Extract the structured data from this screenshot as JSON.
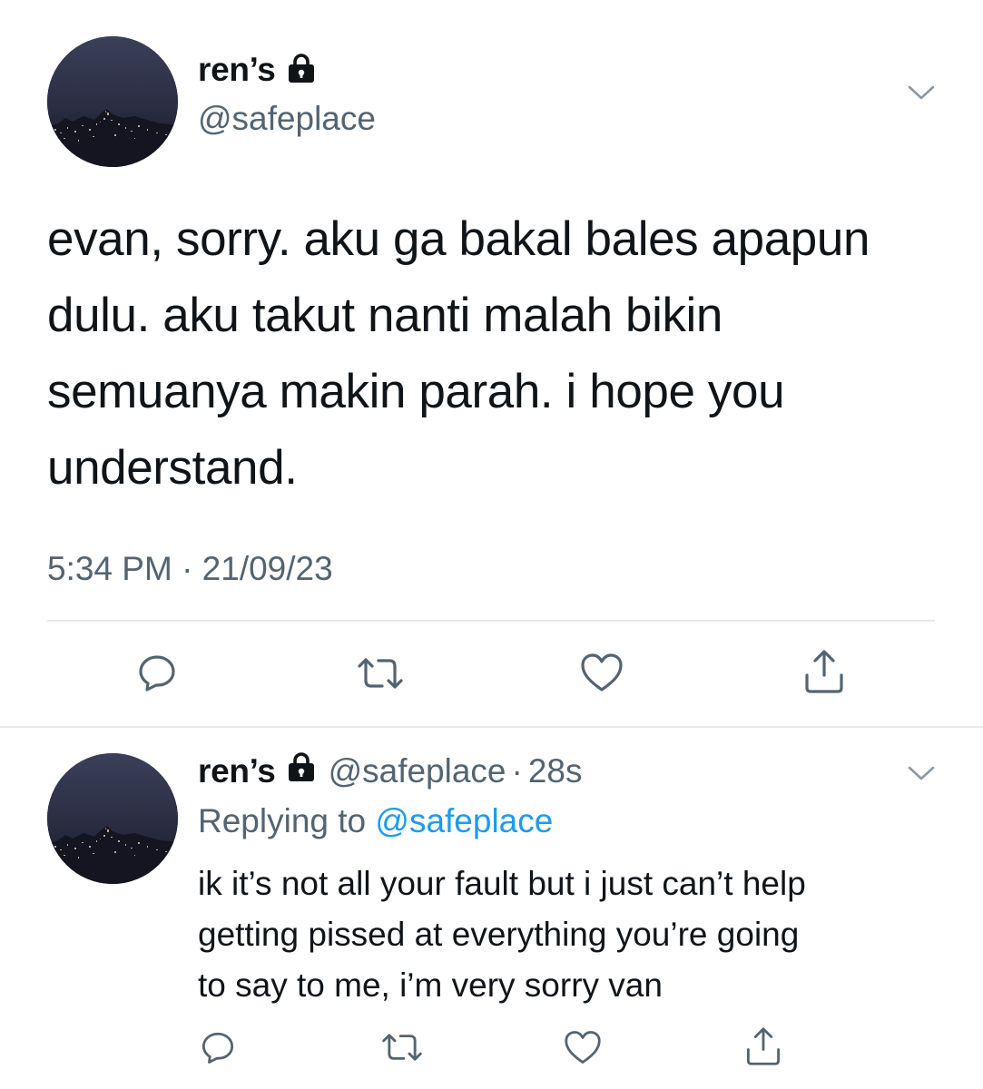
{
  "main_tweet": {
    "author_name": "ren’s",
    "handle": "@safeplace",
    "text": "evan, sorry. aku ga bakal bales apapun\ndulu. aku takut nanti malah bikin\nsemuanya makin parah. i hope you\nunderstand.",
    "timestamp": "5:34 PM · 21/09/23",
    "icons": {
      "protected": "lock-icon",
      "menu": "chevron-down-icon",
      "actions": [
        "reply-icon",
        "retweet-icon",
        "like-icon",
        "share-icon"
      ]
    }
  },
  "reply_tweet": {
    "author_name": "ren’s",
    "handle": "@safeplace",
    "separator": "·",
    "age": "28s",
    "replying_prefix": "Replying to",
    "replying_to": "@safeplace",
    "text": "ik it’s not all your fault but i just can’t help\ngetting pissed at everything you’re going\nto say to me, i’m very sorry van",
    "icons": {
      "protected": "lock-icon",
      "menu": "chevron-down-icon",
      "actions": [
        "reply-icon",
        "retweet-icon",
        "like-icon",
        "share-icon"
      ]
    }
  },
  "colors": {
    "text_primary": "#0f1419",
    "text_secondary": "#536471",
    "link": "#1d9bf0",
    "divider": "#e6e9ec"
  }
}
